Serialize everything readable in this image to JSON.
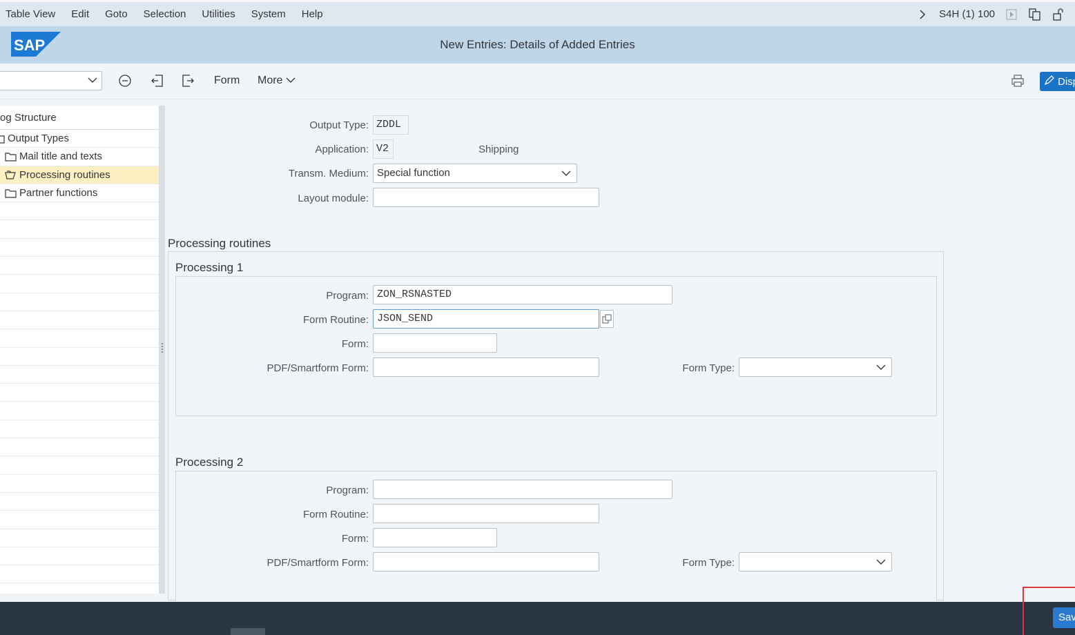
{
  "menubar": {
    "items": [
      "Table View",
      "Edit",
      "Goto",
      "Selection",
      "Utilities",
      "System",
      "Help"
    ],
    "system_info": "S4H (1) 100"
  },
  "header": {
    "logo_text": "SAP",
    "title": "New Entries: Details of Added Entries"
  },
  "toolbar": {
    "form_label": "Form",
    "more_label": "More",
    "display_label": "Disp"
  },
  "sidebar": {
    "title": "og Structure",
    "items": [
      {
        "label": "Output Types",
        "icon": "folder-open-icon"
      },
      {
        "label": "Mail title and texts",
        "icon": "folder-icon"
      },
      {
        "label": "Processing routines",
        "icon": "folder-open-icon",
        "selected": true
      },
      {
        "label": "Partner functions",
        "icon": "folder-icon"
      }
    ]
  },
  "header_fields": {
    "output_type_label": "Output Type:",
    "output_type_value": "ZDDL",
    "application_label": "Application:",
    "application_value": "V2",
    "application_text": "Shipping",
    "transm_medium_label": "Transm. Medium:",
    "transm_medium_value": "Special function",
    "layout_module_label": "Layout module:",
    "layout_module_value": ""
  },
  "processing_routines": {
    "title": "Processing routines",
    "processing1": {
      "title": "Processing 1",
      "program_label": "Program:",
      "program_value": "ZON_RSNASTED",
      "form_routine_label": "Form Routine:",
      "form_routine_value": "JSON_SEND",
      "form_label": "Form:",
      "form_value": "",
      "pdf_form_label": "PDF/Smartform Form:",
      "pdf_form_value": "",
      "form_type_label": "Form Type:",
      "form_type_value": ""
    },
    "processing2": {
      "title": "Processing 2",
      "program_label": "Program:",
      "program_value": "",
      "form_routine_label": "Form Routine:",
      "form_routine_value": "",
      "form_label": "Form:",
      "form_value": "",
      "pdf_form_label": "PDF/Smartform Form:",
      "pdf_form_value": "",
      "form_type_label": "Form Type:",
      "form_type_value": ""
    }
  },
  "footer": {
    "save_label": "Sav"
  },
  "colors": {
    "menubar_bg": "#dfe8f1",
    "titlebar_bg": "#bfd5e8",
    "selected_row": "#fdf0c2",
    "footer_bg": "#293542",
    "primary_button": "#2a7bd0",
    "highlight": "#d9363e"
  }
}
